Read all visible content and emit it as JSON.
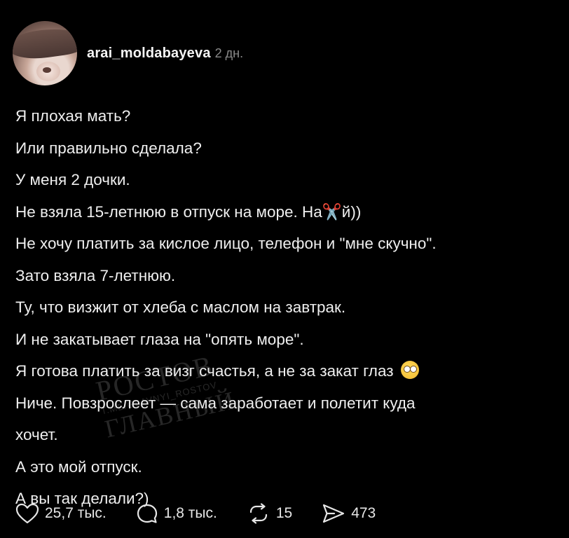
{
  "post": {
    "username": "arai_moldabayeva",
    "time": "2 дн.",
    "lines": [
      "Я плохая мать?",
      "Или правильно сделала?",
      "У меня 2 дочки.",
      "Не взяла 15-летнюю в отпуск на море. На✂️й))",
      "Не хочу платить за кислое лицо, телефон и \"мне скучно\".",
      "Зато взяла 7-летнюю.",
      "Ту, что визжит от хлеба с маслом на завтрак.",
      "И не закатывает глаза на \"опять море\".",
      "Я готова платить за визг счастья, а не за закат глаз",
      "Ниче. Повзрослеет — сама заработает и полетит куда",
      "хочет.",
      "А это мой отпуск.",
      "А вы так делали?)"
    ]
  },
  "watermark": {
    "line1": "РОСТОВ",
    "line2": "T.ME/GLAVNYI_ROSTOV",
    "line3": "ГЛАВНЫЙ"
  },
  "actions": {
    "likes": "25,7 тыс.",
    "comments": "1,8 тыс.",
    "reposts": "15",
    "shares": "473"
  },
  "icons": {
    "like": "heart-icon",
    "comment": "comment-icon",
    "repost": "repost-icon",
    "share": "share-icon",
    "emoji": "eye-roll-emoji-icon"
  }
}
